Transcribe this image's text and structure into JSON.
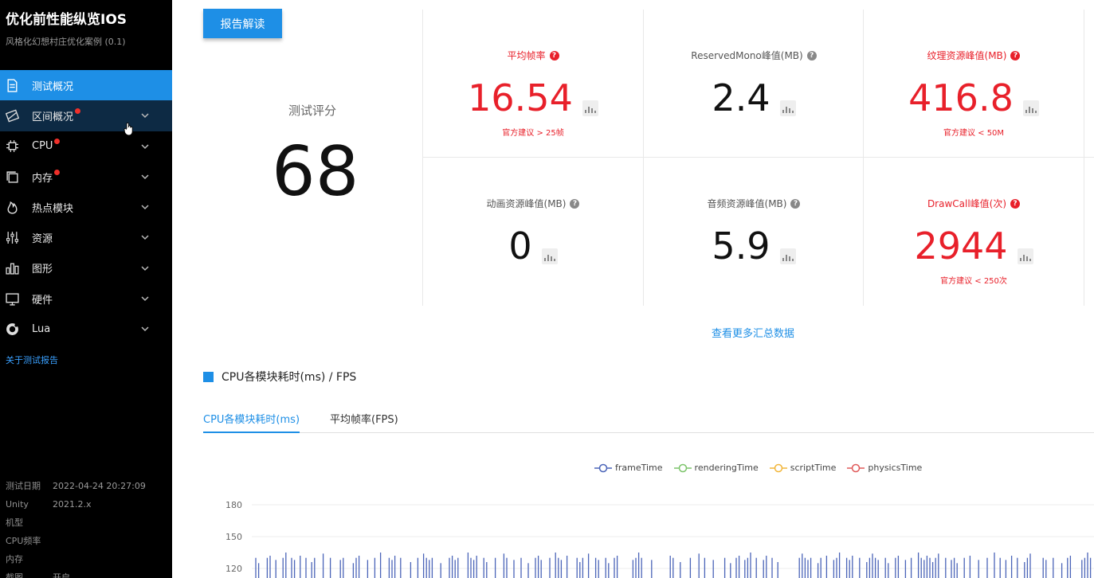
{
  "app": {
    "title": "优化前性能纵览IOS",
    "subtitle": "风格化幻想村庄优化案例 (0.1)"
  },
  "sidebar": {
    "items": [
      {
        "label": "测试概况",
        "icon": "document-icon",
        "active": true,
        "dot": false,
        "chevron": false
      },
      {
        "label": "区间概况",
        "icon": "range-icon",
        "active": false,
        "dot": true,
        "chevron": true
      },
      {
        "label": "CPU",
        "icon": "chip-icon",
        "active": false,
        "dot": true,
        "chevron": true
      },
      {
        "label": "内存",
        "icon": "memory-icon",
        "active": false,
        "dot": true,
        "chevron": true
      },
      {
        "label": "热点模块",
        "icon": "flame-icon",
        "active": false,
        "dot": false,
        "chevron": true
      },
      {
        "label": "资源",
        "icon": "sliders-icon",
        "active": false,
        "dot": false,
        "chevron": true
      },
      {
        "label": "图形",
        "icon": "bar-chart-icon",
        "active": false,
        "dot": false,
        "chevron": true
      },
      {
        "label": "硬件",
        "icon": "monitor-icon",
        "active": false,
        "dot": false,
        "chevron": true
      },
      {
        "label": "Lua",
        "icon": "lua-icon",
        "active": false,
        "dot": false,
        "chevron": true
      }
    ],
    "about_link": "关于测试报告",
    "meta": [
      {
        "key": "测试日期",
        "value": "2022-04-24 20:27:09"
      },
      {
        "key": "Unity",
        "value": "2021.2.x"
      },
      {
        "key": "机型",
        "value": ""
      },
      {
        "key": "CPU频率",
        "value": ""
      },
      {
        "key": "内存",
        "value": ""
      },
      {
        "key": "截图",
        "value": "开启"
      }
    ]
  },
  "header": {
    "report_button": "报告解读"
  },
  "score": {
    "label": "测试评分",
    "value": "68"
  },
  "metrics": [
    {
      "title": "平均帧率",
      "value": "16.54",
      "note": "官方建议 > 25帧",
      "warn": true
    },
    {
      "title": "ReservedMono峰值(MB)",
      "value": "2.4",
      "note": "",
      "warn": false
    },
    {
      "title": "纹理资源峰值(MB)",
      "value": "416.8",
      "note": "官方建议 < 50M",
      "warn": true
    },
    {
      "title": "动画资源峰值(MB)",
      "value": "0",
      "note": "",
      "warn": false
    },
    {
      "title": "音频资源峰值(MB)",
      "value": "5.9",
      "note": "",
      "warn": false
    },
    {
      "title": "DrawCall峰值(次)",
      "value": "2944",
      "note": "官方建议 < 250次",
      "warn": true
    }
  ],
  "more_link": "查看更多汇总数据",
  "section": {
    "title": "CPU各模块耗时(ms) / FPS"
  },
  "tabs": [
    {
      "label": "CPU各模块耗时(ms)",
      "active": true
    },
    {
      "label": "平均帧率(FPS)",
      "active": false
    }
  ],
  "colors": {
    "accent": "#1e8fe6",
    "warn": "#e8202a",
    "sidebar_bg": "#000000"
  },
  "chart_data": {
    "type": "bar",
    "series": [
      {
        "name": "frameTime",
        "color": "#4a64b8"
      },
      {
        "name": "renderingTime",
        "color": "#7cc46a"
      },
      {
        "name": "scriptTime",
        "color": "#f2b63a"
      },
      {
        "name": "physicsTime",
        "color": "#e05a5a"
      }
    ],
    "y_ticks": [
      "180",
      "150",
      "120"
    ],
    "ylim": [
      120,
      180
    ],
    "frameTime_spikes_approx": [
      130,
      125,
      130,
      132,
      128,
      130,
      135,
      130,
      128,
      132,
      130,
      126,
      130,
      134,
      130,
      128
    ],
    "grid": true
  }
}
